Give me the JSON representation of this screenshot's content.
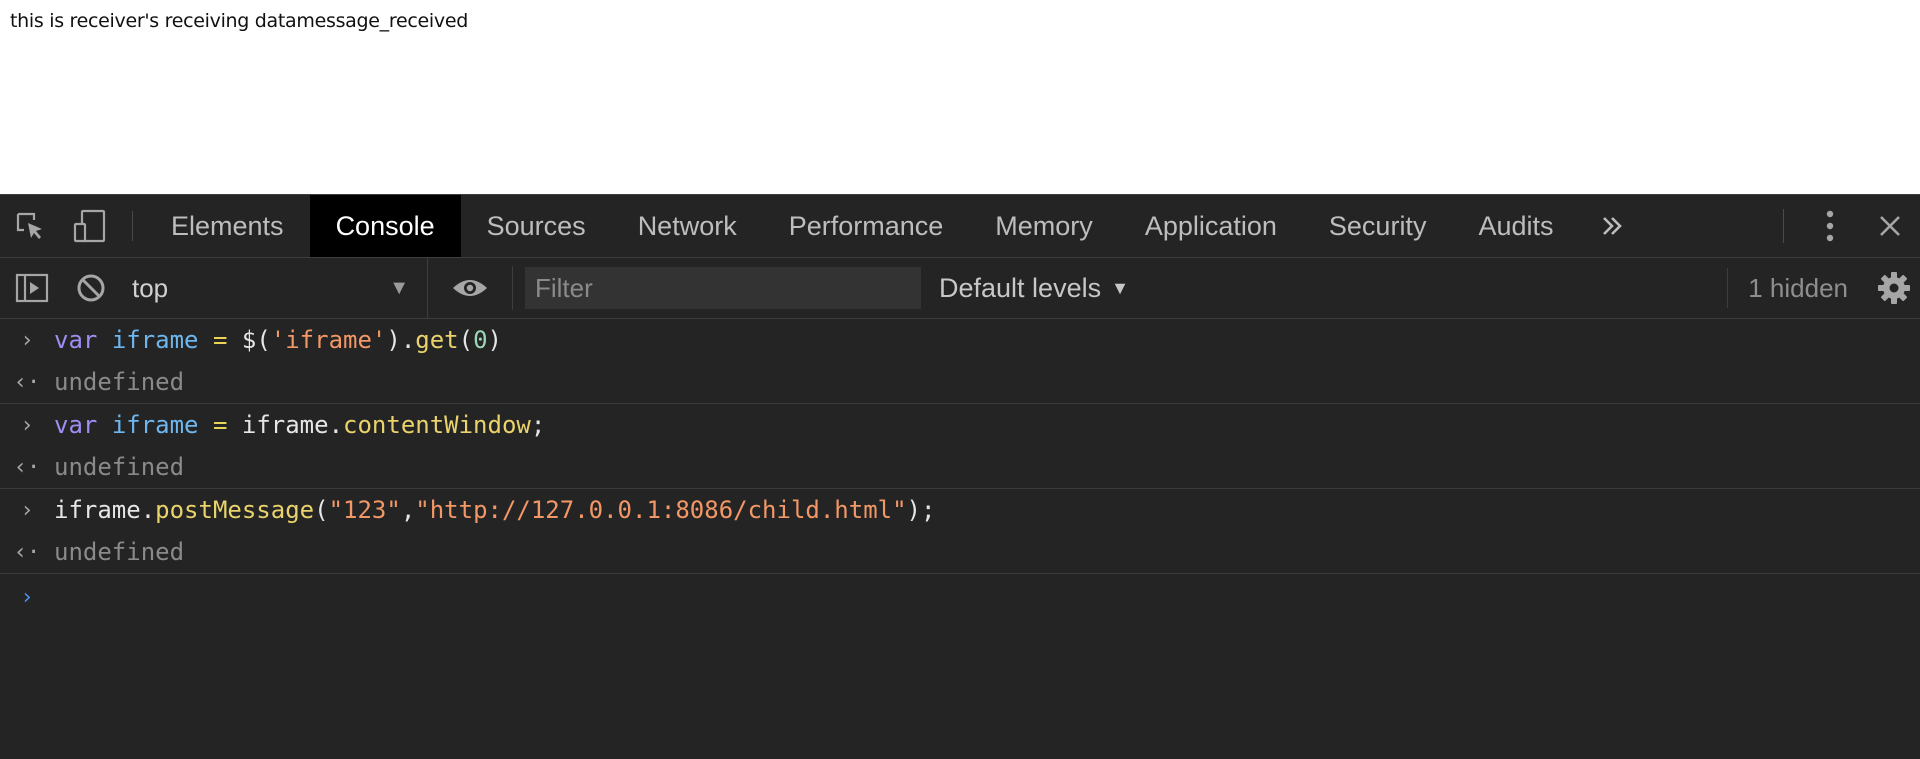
{
  "page": {
    "text": "this is receiver's receiving datamessage_received"
  },
  "devtools": {
    "tabs": [
      "Elements",
      "Console",
      "Sources",
      "Network",
      "Performance",
      "Memory",
      "Application",
      "Security",
      "Audits"
    ],
    "active_tab": "Console",
    "icons": {
      "inspect": "inspect-element-icon",
      "device": "device-toolbar-icon",
      "more_tabs": "more-tabs-icon",
      "menu": "kebab-menu-icon",
      "close": "close-icon"
    }
  },
  "console_toolbar": {
    "context": "top",
    "filter_placeholder": "Filter",
    "levels": "Default levels",
    "hidden": "1 hidden",
    "icons": {
      "sidebar": "show-sidebar-icon",
      "clear": "clear-console-icon",
      "eye": "live-expression-eye-icon",
      "settings": "gear-icon"
    }
  },
  "console": {
    "entries": [
      {
        "input": "var iframe = $('iframe').get(0)",
        "result": "undefined"
      },
      {
        "input": "var iframe = iframe.contentWindow;",
        "result": "undefined"
      },
      {
        "input": "iframe.postMessage(\"123\",\"http://127.0.0.1:8086/child.html\");",
        "result": "undefined"
      }
    ],
    "token_colors": {
      "keyword": "#9c8ef2",
      "variable": "#6eb6ee",
      "string": "#f29766",
      "number": "#9bd6b5",
      "function": "#e9d36a",
      "prompt": "#4a8ff0"
    }
  }
}
